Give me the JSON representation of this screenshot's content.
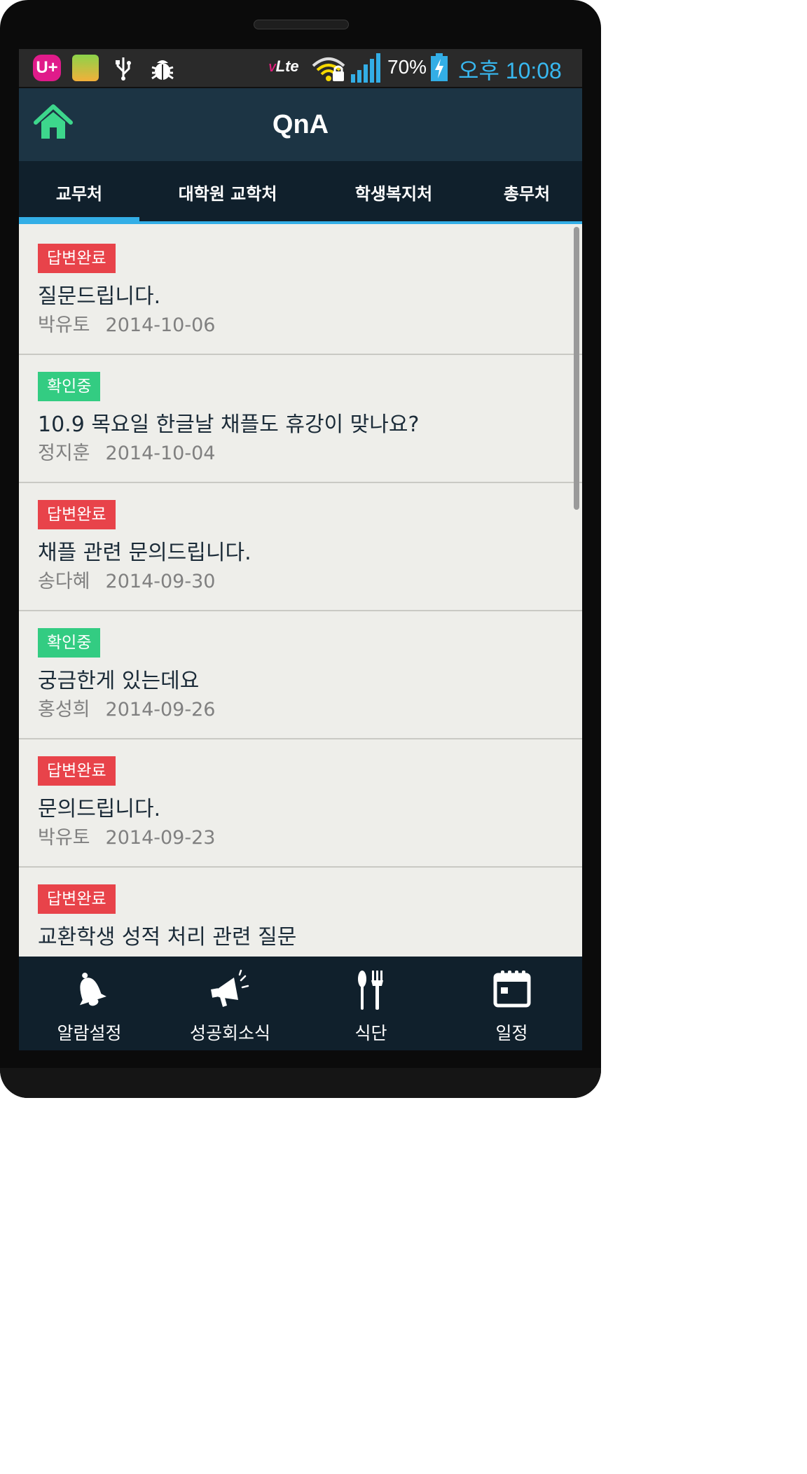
{
  "status_bar": {
    "uplus": "U+",
    "network": "Lte",
    "battery": "70%",
    "time": "오후 10:08"
  },
  "header": {
    "title": "QnA"
  },
  "tabs": [
    {
      "label": "교무처",
      "selected": true
    },
    {
      "label": "대학원 교학처",
      "selected": false
    },
    {
      "label": "학생복지처",
      "selected": false
    },
    {
      "label": "총무처",
      "selected": false
    }
  ],
  "qna_items": [
    {
      "status": "답변완료",
      "status_color": "#e8434a",
      "title": "질문드립니다.",
      "author": "박유토",
      "date": "2014-10-06"
    },
    {
      "status": "확인중",
      "status_color": "#33cc82",
      "title": "10.9 목요일 한글날 채플도 휴강이 맞나요?",
      "author": "정지훈",
      "date": "2014-10-04"
    },
    {
      "status": "답변완료",
      "status_color": "#e8434a",
      "title": "채플 관련 문의드립니다.",
      "author": "송다혜",
      "date": "2014-09-30"
    },
    {
      "status": "확인중",
      "status_color": "#33cc82",
      "title": "궁금한게 있는데요",
      "author": "홍성희",
      "date": "2014-09-26"
    },
    {
      "status": "답변완료",
      "status_color": "#e8434a",
      "title": "문의드립니다.",
      "author": "박유토",
      "date": "2014-09-23"
    },
    {
      "status": "답변완료",
      "status_color": "#e8434a",
      "title": "교환학생 성적 처리 관련 질문",
      "author": "",
      "date": ""
    }
  ],
  "bottom_nav": [
    {
      "label": "알람설정",
      "icon": "bell-icon"
    },
    {
      "label": "성공회소식",
      "icon": "megaphone-icon"
    },
    {
      "label": "식단",
      "icon": "utensils-icon"
    },
    {
      "label": "일정",
      "icon": "calendar-icon"
    }
  ],
  "colors": {
    "accent": "#33aee6",
    "header_bg": "#1c3444",
    "nav_bg": "#10202c",
    "home_icon": "#3dd68c"
  }
}
